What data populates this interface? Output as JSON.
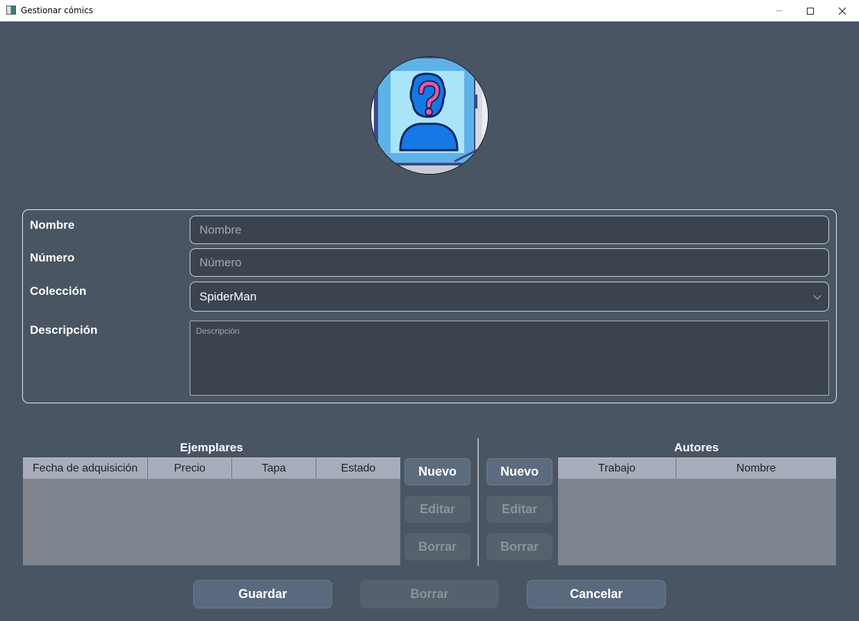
{
  "window": {
    "title": "Gestionar cómics"
  },
  "form": {
    "nombre_label": "Nombre",
    "nombre_placeholder": "Nombre",
    "numero_label": "Número",
    "numero_placeholder": "Número",
    "coleccion_label": "Colección",
    "coleccion_value": "SpiderMan",
    "descripcion_label": "Descripción",
    "descripcion_placeholder": "Descripción"
  },
  "ejemplares": {
    "title": "Ejemplares",
    "columns": [
      "Fecha de adquisición",
      "Precio",
      "Tapa",
      "Estado"
    ],
    "buttons": {
      "nuevo": "Nuevo",
      "editar": "Editar",
      "borrar": "Borrar"
    }
  },
  "autores": {
    "title": "Autores",
    "columns": [
      "Trabajo",
      "Nombre"
    ],
    "buttons": {
      "nuevo": "Nuevo",
      "editar": "Editar",
      "borrar": "Borrar"
    }
  },
  "actions": {
    "guardar": "Guardar",
    "borrar": "Borrar",
    "cancelar": "Cancelar"
  },
  "colors": {
    "background": "#4a5564",
    "input_bg": "#3a434e",
    "table_header": "#a8adbb",
    "table_body": "#7e858f",
    "button_active": "#5c6b7e"
  },
  "icons": {
    "avatar": "unknown-person-icon"
  }
}
